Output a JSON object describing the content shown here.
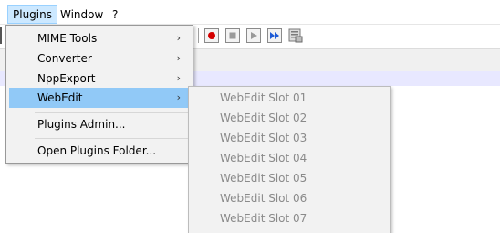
{
  "menubar": {
    "items": [
      {
        "label": "Plugins",
        "active": true
      },
      {
        "label": "Window"
      },
      {
        "label": "?"
      }
    ]
  },
  "toolbar": {
    "buttons": [
      "record-macro-icon",
      "stop-recording-icon",
      "playback-icon",
      "run-macro-multiple-icon",
      "save-macro-icon"
    ],
    "record_color": "#d40000",
    "playback_color": "#1e5bd6"
  },
  "plugins_menu": {
    "items": [
      {
        "label": "MIME Tools",
        "has_submenu": true
      },
      {
        "label": "Converter",
        "has_submenu": true
      },
      {
        "label": "NppExport",
        "has_submenu": true
      },
      {
        "label": "WebEdit",
        "has_submenu": true,
        "highlighted": true
      },
      {
        "label": "Plugins Admin..."
      },
      {
        "label": "Open Plugins Folder..."
      }
    ],
    "submenu_arrow": "›",
    "highlight_color": "#91c9f7"
  },
  "webedit_submenu": {
    "items": [
      {
        "label": "WebEdit Slot 01",
        "enabled": false
      },
      {
        "label": "WebEdit Slot 02",
        "enabled": false
      },
      {
        "label": "WebEdit Slot 03",
        "enabled": false
      },
      {
        "label": "WebEdit Slot 04",
        "enabled": false
      },
      {
        "label": "WebEdit Slot 05",
        "enabled": false
      },
      {
        "label": "WebEdit Slot 06",
        "enabled": false
      },
      {
        "label": "WebEdit Slot 07",
        "enabled": false
      }
    ]
  }
}
